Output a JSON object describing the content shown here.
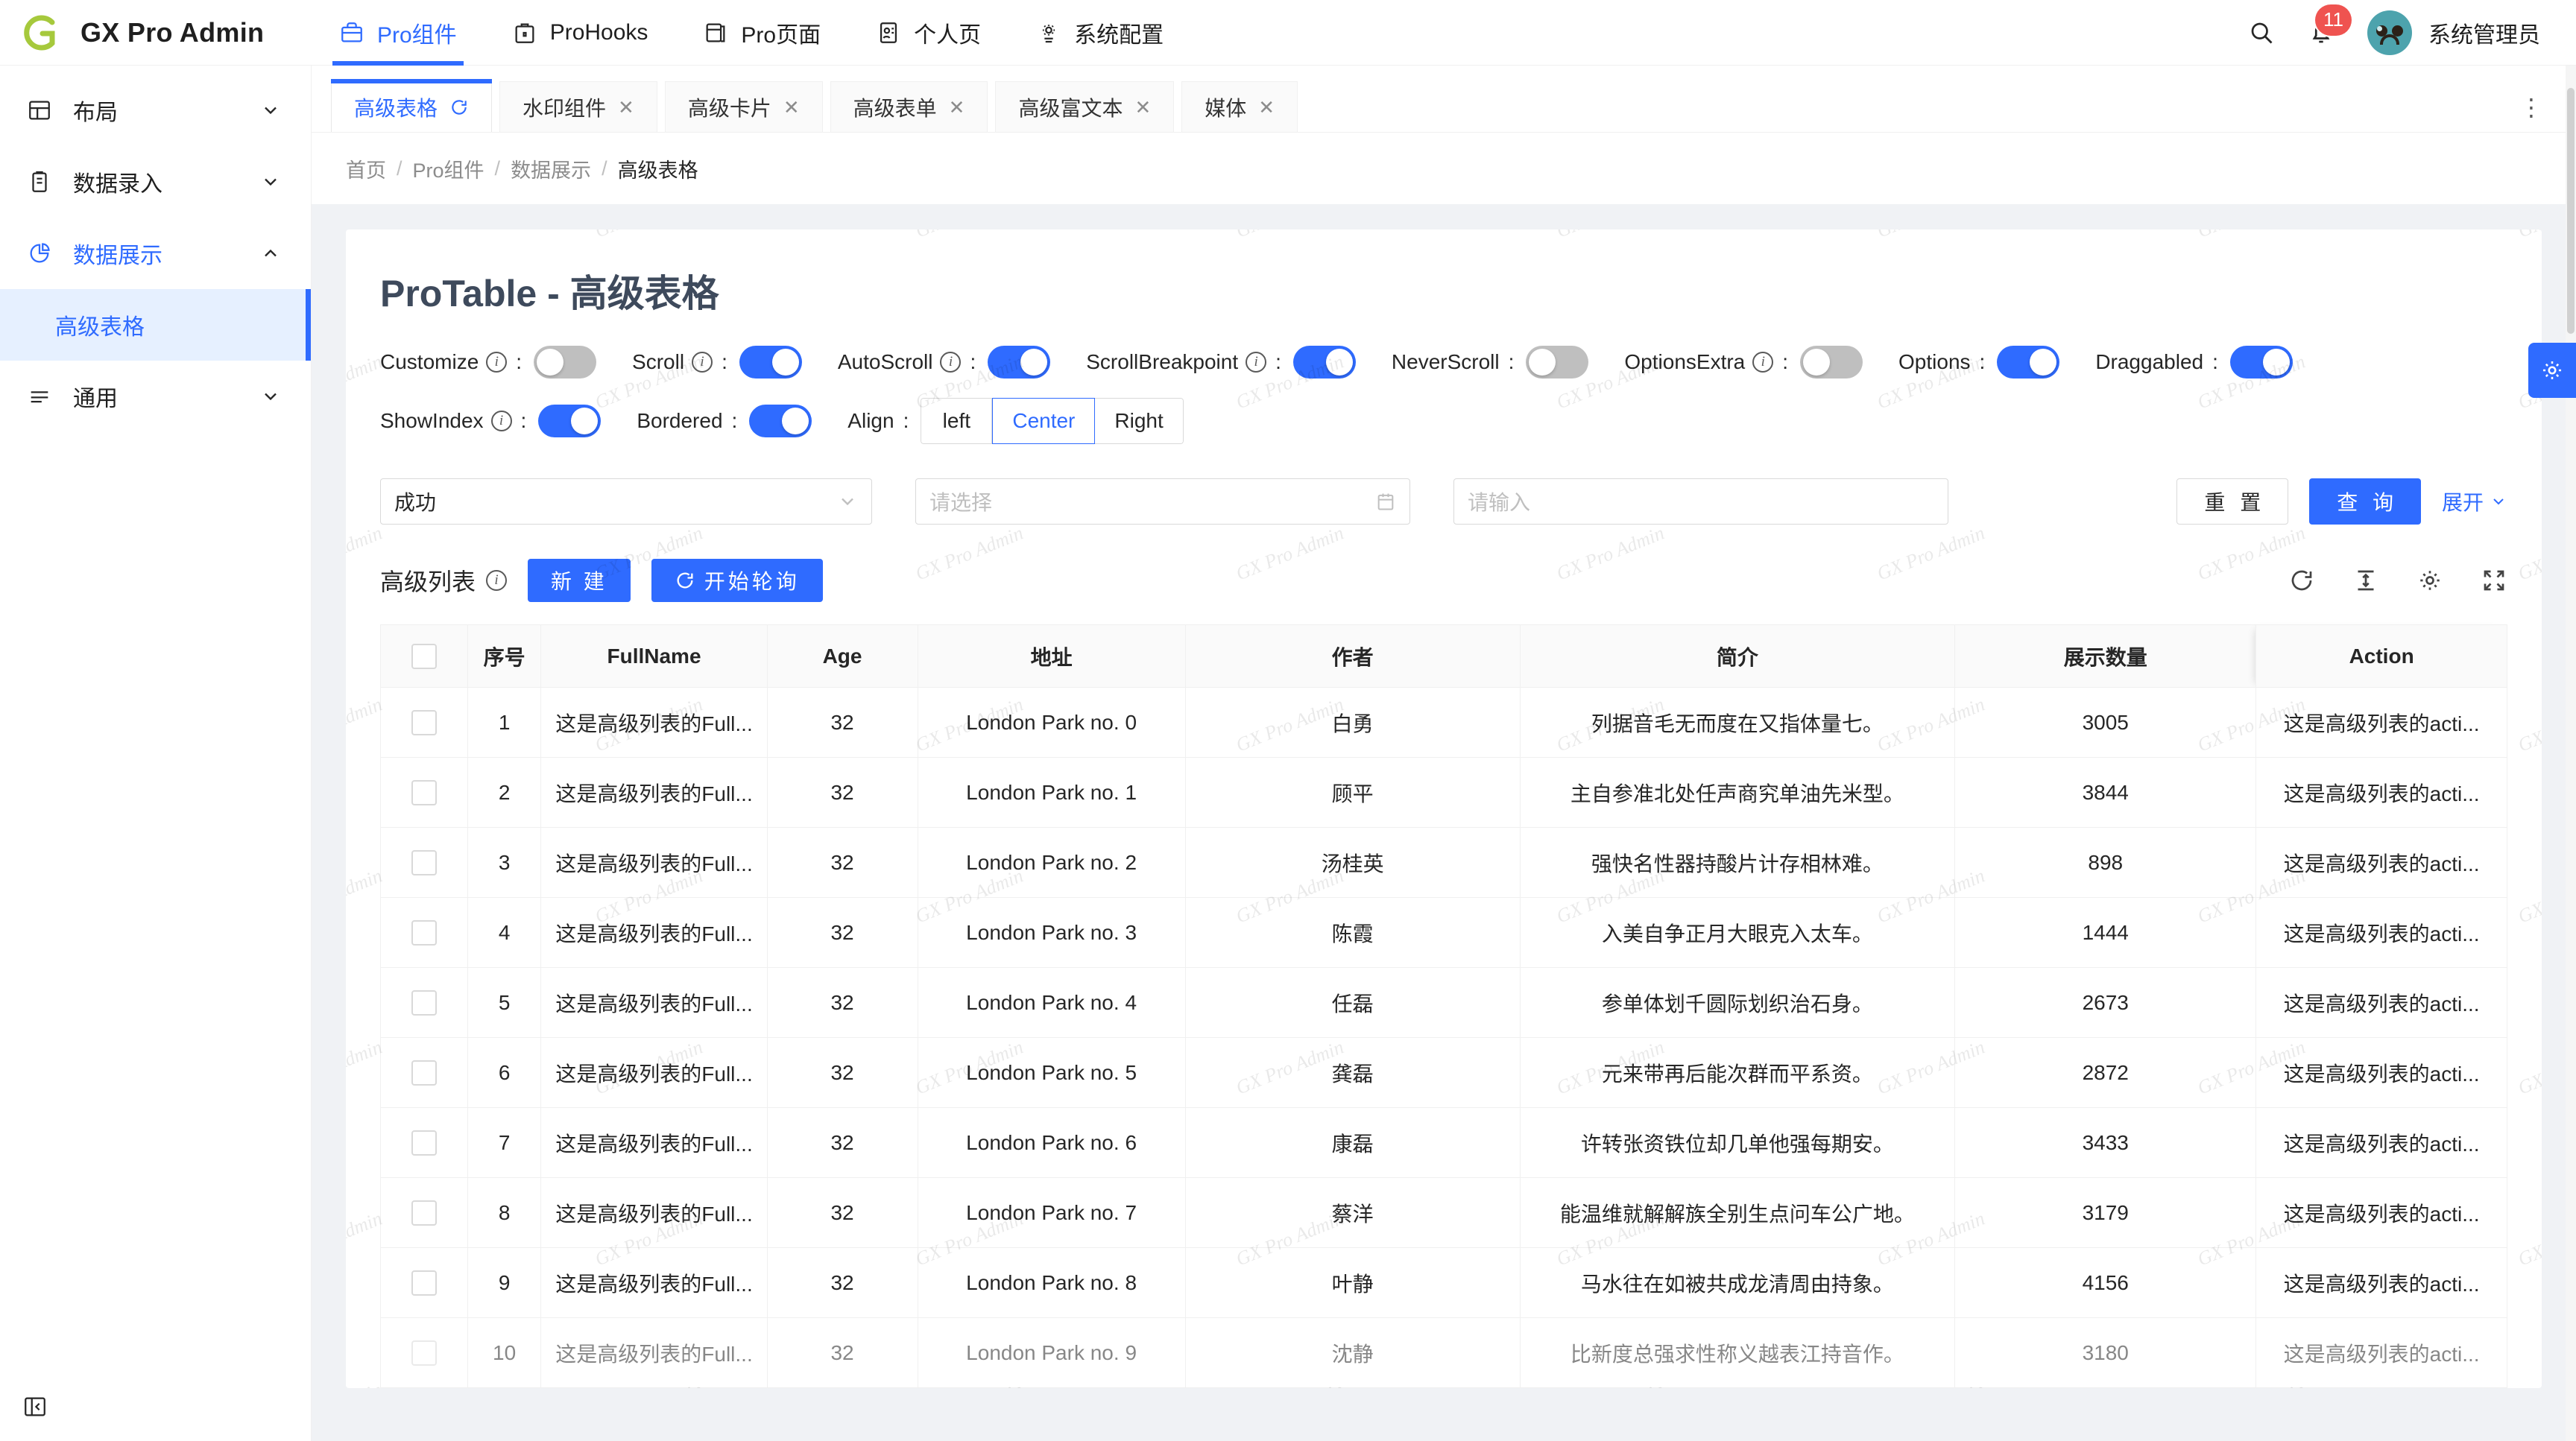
{
  "header": {
    "logo_text": "GX Pro Admin",
    "nav": [
      {
        "label": "Pro组件",
        "icon": "briefcase-icon",
        "active": true
      },
      {
        "label": "ProHooks",
        "icon": "toolbox-icon",
        "active": false
      },
      {
        "label": "Pro页面",
        "icon": "window-icon",
        "active": false
      },
      {
        "label": "个人页",
        "icon": "id-card-icon",
        "active": false
      },
      {
        "label": "系统配置",
        "icon": "gear-icon",
        "active": false
      }
    ],
    "search_icon": "search-icon",
    "bell_icon": "bell-icon",
    "notification_count": "11",
    "user_name": "系统管理员",
    "avatar_color": "#4da3ad",
    "badge_color": "#ef5350"
  },
  "sidebar": {
    "items": [
      {
        "label": "布局",
        "icon": "layout-icon",
        "expanded": false,
        "active": false
      },
      {
        "label": "数据录入",
        "icon": "clipboard-icon",
        "expanded": false,
        "active": false
      },
      {
        "label": "数据展示",
        "icon": "pie-chart-icon",
        "expanded": true,
        "active": true
      },
      {
        "label": "通用",
        "icon": "list-icon",
        "expanded": false,
        "active": false
      }
    ],
    "submenu": [
      {
        "label": "高级表格",
        "selected": true
      }
    ],
    "collapse_icon": "collapse-sidebar-icon"
  },
  "tabs": {
    "items": [
      {
        "label": "高级表格",
        "active": true,
        "closable": false,
        "icon": "refresh-icon"
      },
      {
        "label": "水印组件",
        "active": false,
        "closable": true
      },
      {
        "label": "高级卡片",
        "active": false,
        "closable": true
      },
      {
        "label": "高级表单",
        "active": false,
        "closable": true
      },
      {
        "label": "高级富文本",
        "active": false,
        "closable": true
      },
      {
        "label": "媒体",
        "active": false,
        "closable": true
      }
    ],
    "more_icon": "more-vertical-icon"
  },
  "breadcrumb": [
    "首页",
    "Pro组件",
    "数据展示",
    "高级表格"
  ],
  "page": {
    "title": "ProTable - 高级表格",
    "watermark_text": "GX Pro Admin"
  },
  "controls": {
    "row1": [
      {
        "label": "Customize",
        "info": true,
        "on": false
      },
      {
        "label": "Scroll",
        "info": true,
        "on": true
      },
      {
        "label": "AutoScroll",
        "info": true,
        "on": true
      },
      {
        "label": "ScrollBreakpoint",
        "info": true,
        "on": true
      },
      {
        "label": "NeverScroll",
        "info": false,
        "on": false
      },
      {
        "label": "OptionsExtra",
        "info": true,
        "on": false
      },
      {
        "label": "Options",
        "info": false,
        "on": true
      },
      {
        "label": "Draggabled",
        "info": false,
        "on": true
      }
    ],
    "row2": [
      {
        "label": "ShowIndex",
        "info": true,
        "on": true
      },
      {
        "label": "Bordered",
        "info": false,
        "on": true
      }
    ],
    "align": {
      "label": "Align",
      "options": [
        "left",
        "Center",
        "Right"
      ],
      "selected": "Center"
    }
  },
  "filters": {
    "status_value": "成功",
    "date_placeholder": "请选择",
    "text_placeholder": "请输入",
    "reset_label": "重 置",
    "search_label": "查 询",
    "expand_label": "展开",
    "dropdown_icon": "chevron-down-icon",
    "calendar_icon": "calendar-icon"
  },
  "table_toolbar": {
    "title": "高级列表",
    "info": true,
    "new_label": "新 建",
    "poll_label": "开始轮询",
    "poll_icon": "refresh-icon",
    "icons": [
      "refresh-icon",
      "row-height-icon",
      "gear-icon",
      "fullscreen-icon"
    ]
  },
  "table": {
    "columns": [
      "序号",
      "FullName",
      "Age",
      "地址",
      "作者",
      "简介",
      "展示数量",
      "Action"
    ],
    "select_all_checkbox": false,
    "action_text": "这是高级列表的acti...",
    "rows": [
      {
        "index": "1",
        "fullname": "这是高级列表的Full...",
        "age": "32",
        "address": "London Park no. 0",
        "author": "白勇",
        "desc": "列据音毛无而度在又指体量七。",
        "count": "3005"
      },
      {
        "index": "2",
        "fullname": "这是高级列表的Full...",
        "age": "32",
        "address": "London Park no. 1",
        "author": "顾平",
        "desc": "主自参准北处任声商究单油先米型。",
        "count": "3844"
      },
      {
        "index": "3",
        "fullname": "这是高级列表的Full...",
        "age": "32",
        "address": "London Park no. 2",
        "author": "汤桂英",
        "desc": "强快名性器持酸片计存相林难。",
        "count": "898"
      },
      {
        "index": "4",
        "fullname": "这是高级列表的Full...",
        "age": "32",
        "address": "London Park no. 3",
        "author": "陈霞",
        "desc": "入美自争正月大眼克入太车。",
        "count": "1444"
      },
      {
        "index": "5",
        "fullname": "这是高级列表的Full...",
        "age": "32",
        "address": "London Park no. 4",
        "author": "任磊",
        "desc": "参单体划千圆际划织治石身。",
        "count": "2673"
      },
      {
        "index": "6",
        "fullname": "这是高级列表的Full...",
        "age": "32",
        "address": "London Park no. 5",
        "author": "龚磊",
        "desc": "元来带再后能次群而平系资。",
        "count": "2872"
      },
      {
        "index": "7",
        "fullname": "这是高级列表的Full...",
        "age": "32",
        "address": "London Park no. 6",
        "author": "康磊",
        "desc": "许转张资铁位却几单他强每期安。",
        "count": "3433"
      },
      {
        "index": "8",
        "fullname": "这是高级列表的Full...",
        "age": "32",
        "address": "London Park no. 7",
        "author": "蔡洋",
        "desc": "能温维就解解族全别生点问车公广地。",
        "count": "3179"
      },
      {
        "index": "9",
        "fullname": "这是高级列表的Full...",
        "age": "32",
        "address": "London Park no. 8",
        "author": "叶静",
        "desc": "马水往在如被共成龙清周由持象。",
        "count": "4156"
      },
      {
        "index": "10",
        "fullname": "这是高级列表的Full...",
        "age": "32",
        "address": "London Park no. 9",
        "author": "沈静",
        "desc": "比新度总强求性称义越表江持音作。",
        "count": "3180"
      }
    ]
  },
  "float_settings_icon": "gear-icon",
  "theme": {
    "primary": "#2f6bff",
    "selected_bg": "#e6f0ff",
    "link": "#2f6bff"
  }
}
